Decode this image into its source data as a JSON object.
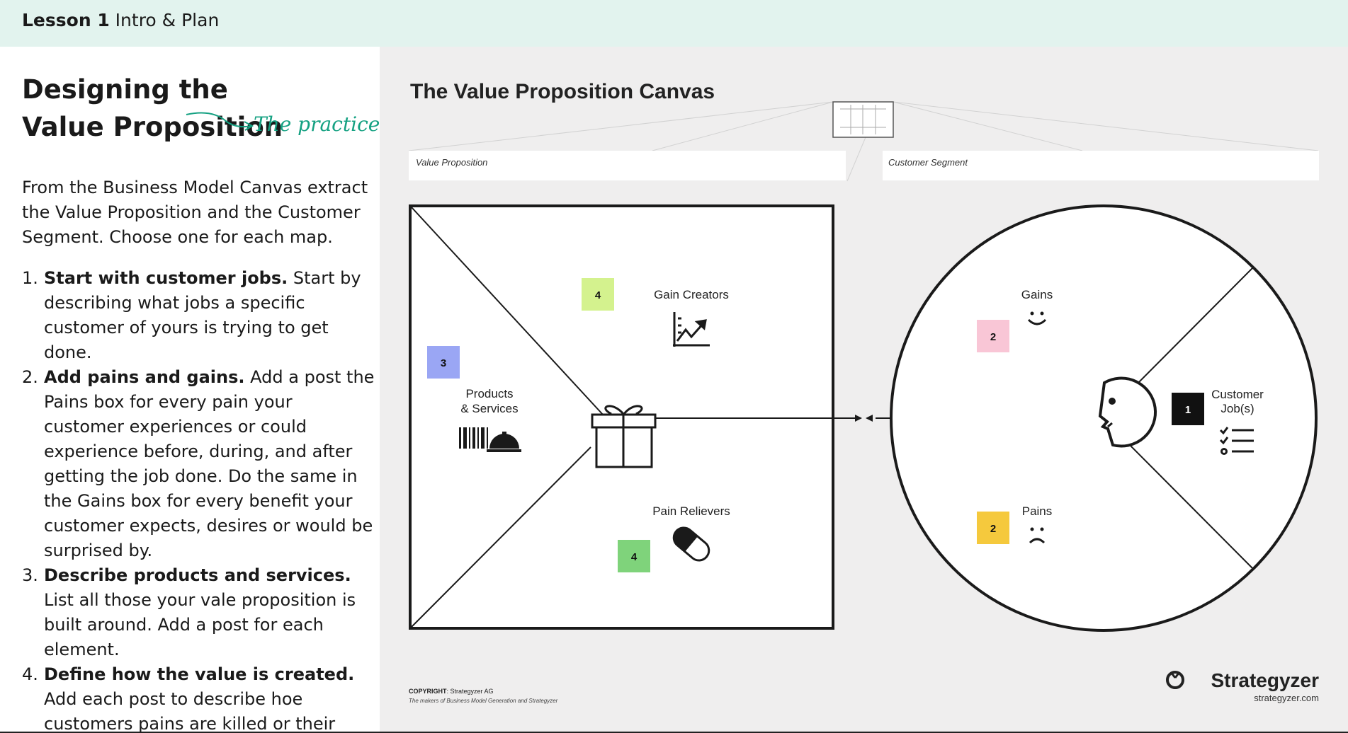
{
  "header": {
    "lesson_number": "Lesson 1",
    "lesson_title": "Intro & Plan"
  },
  "left_panel": {
    "title": "Designing the Value Proposition",
    "practice_label": "The practice",
    "intro": "From the Business Model Canvas extract the Value Proposition and the Customer Segment. Choose one for each map.",
    "steps": [
      {
        "number": "1.",
        "bold": "Start with customer jobs.",
        "text": " Start by describing what jobs a specific customer of yours is trying to get done."
      },
      {
        "number": "2.",
        "bold": "Add pains and gains.",
        "text": " Add a post the Pains box for every pain your customer experiences or could experience before, during, and after getting the job done. Do the same in the Gains box for every benefit your customer expects, desires or would be surprised by."
      },
      {
        "number": "3.",
        "bold": "Describe products and services.",
        "text": " List all those your vale proposition is built around. Add a post for each element."
      },
      {
        "number": "4.",
        "bold": "Define how the value is created.",
        "text": " Add each post to describe hoe customers pains are killed or their gains are created."
      }
    ]
  },
  "canvas": {
    "title": "The Value Proposition Canvas",
    "value_proposition_label": "Value Proposition",
    "customer_segment_label": "Customer Segment",
    "gain_creators": "Gain Creators",
    "pain_relievers": "Pain Relievers",
    "products_line1": "Products",
    "products_line2": "& Services",
    "gains": "Gains",
    "pains": "Pains",
    "customer_jobs_line1": "Customer",
    "customer_jobs_line2": "Job(s)",
    "notes": {
      "gain_creators": "4",
      "pain_relievers": "4",
      "products": "3",
      "gains": "2",
      "pains": "2",
      "jobs": "1"
    },
    "note_colors": {
      "gain_creators": "#d4f28e",
      "pain_relievers": "#7fd37b",
      "products": "#9aa6f4",
      "gains": "#f9c6d6",
      "pains": "#f5c93d",
      "jobs": "#111111"
    },
    "copyright_label": "COPYRIGHT",
    "copyright_text": ": Strategyzer AG",
    "copyright_sub": "The makers of Business Model Generation and Strategyzer",
    "brand": "Strategyzer",
    "brand_url": "strategyzer.com"
  }
}
